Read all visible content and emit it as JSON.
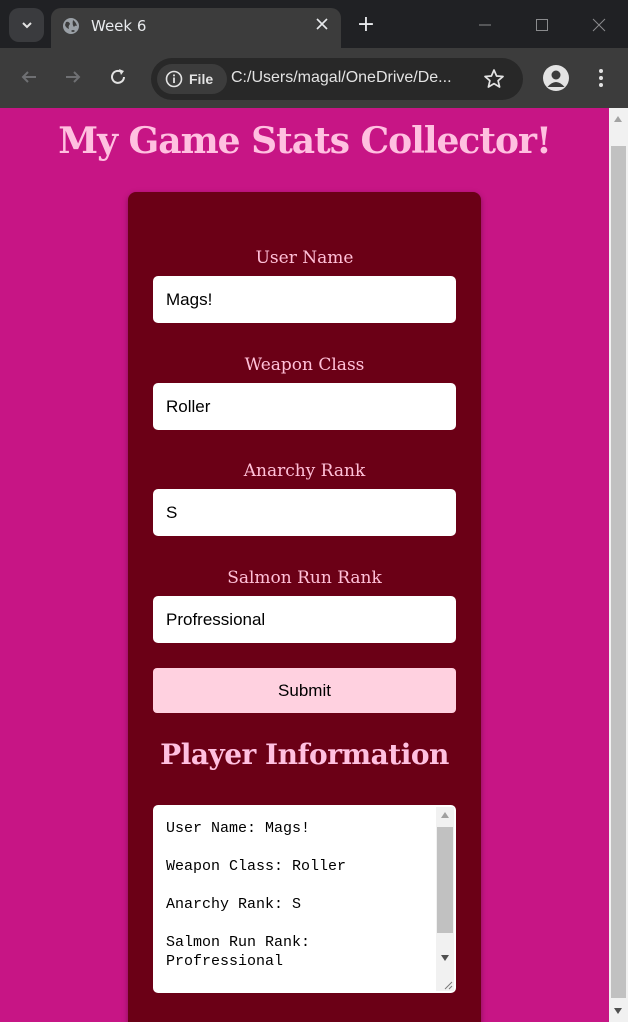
{
  "browser": {
    "tab_title": "Week 6",
    "new_tab_icon": "+",
    "security_chip_label": "File",
    "url": "C:/Users/magal/OneDrive/De..."
  },
  "page": {
    "title": "My Game Stats Collector!",
    "background_color": "#c71585",
    "card_color": "#6b0016",
    "accent_text_color": "#ffc0e0",
    "form": {
      "fields": [
        {
          "label": "User Name",
          "value": "Mags!"
        },
        {
          "label": "Weapon Class",
          "value": "Roller"
        },
        {
          "label": "Anarchy Rank",
          "value": "S"
        },
        {
          "label": "Salmon Run Rank",
          "value": "Profressional"
        }
      ],
      "submit_label": "Submit",
      "submit_color": "#ffd1e0"
    },
    "info": {
      "heading": "Player Information",
      "text": "User Name: Mags!\n\nWeapon Class: Roller\n\nAnarchy Rank: S\n\nSalmon Run Rank:\nProfressional"
    }
  }
}
